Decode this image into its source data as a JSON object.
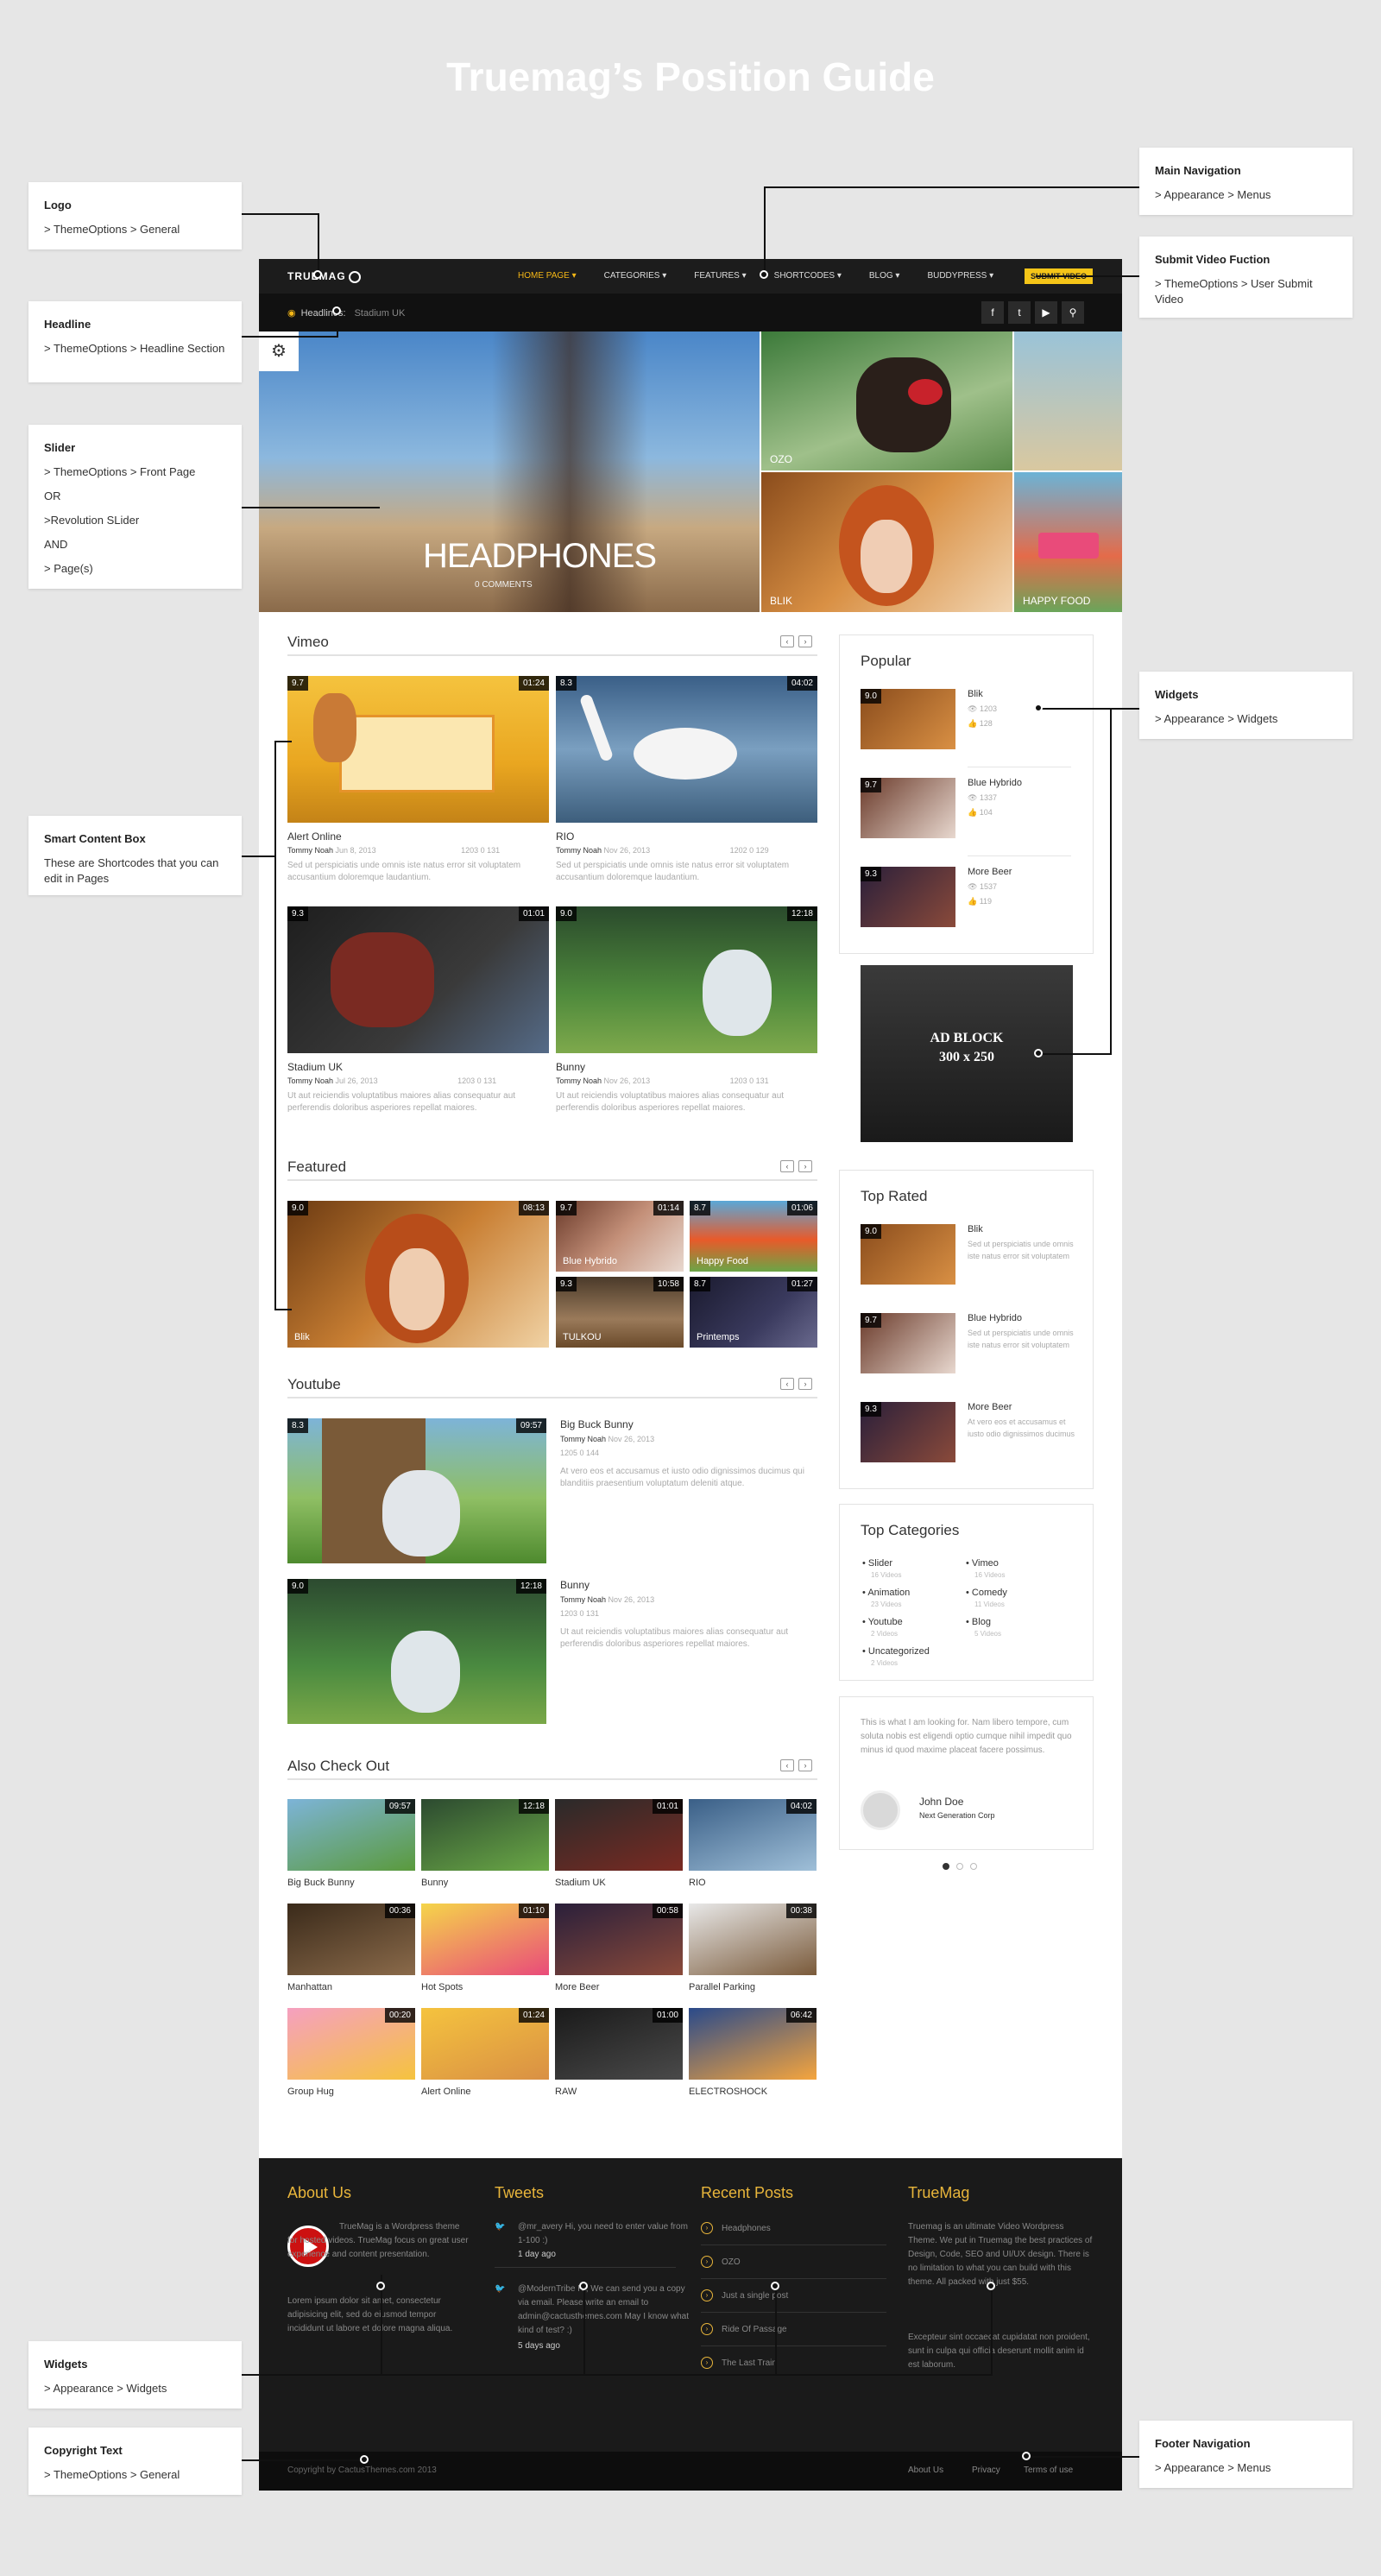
{
  "page_title": "Truemag’s Position Guide",
  "annotations": {
    "logo": {
      "title": "Logo",
      "text": "> ThemeOptions > General"
    },
    "headline": {
      "title": "Headline",
      "text": "> ThemeOptions > Headline Section"
    },
    "slider": {
      "title": "Slider",
      "lines": [
        "> ThemeOptions > Front Page",
        "OR",
        ">Revolution SLider",
        "AND",
        "> Page(s)"
      ]
    },
    "smart": {
      "title": "Smart Content Box",
      "text": "These are Shortcodes that you can edit in Pages"
    },
    "widgets_left": {
      "title": "Widgets",
      "text": "> Appearance > Widgets"
    },
    "copyright": {
      "title": "Copyright Text",
      "text": "> ThemeOptions > General"
    },
    "main_nav": {
      "title": "Main Navigation",
      "text": "> Appearance > Menus"
    },
    "submit": {
      "title": "Submit Video Fuction",
      "text": "> ThemeOptions > User Submit Video"
    },
    "widgets_right": {
      "title": "Widgets",
      "text": "> Appearance > Widgets"
    },
    "footer_nav": {
      "title": "Footer Navigation",
      "text": "> Appearance > Menus"
    }
  },
  "site": {
    "logo": "TRUEMAG",
    "nav": [
      "HOME PAGE ▾",
      "CATEGORIES ▾",
      "FEATURES ▾",
      "SHORTCODES ▾",
      "BLOG ▾",
      "BUDDYPRESS ▾"
    ],
    "submit_label": "SUBMIT VIDEO",
    "headline_label": "Headlines:",
    "headline_value": "Stadium UK",
    "social": [
      "f",
      "t",
      "▶",
      "⚲"
    ]
  },
  "slider": {
    "main_title": "HEADPHONES",
    "main_sub": "0 COMMENTS",
    "items": [
      "OZO",
      "",
      "BLIK",
      "HAPPY FOOD"
    ]
  },
  "sections": {
    "vimeo": "Vimeo",
    "featured": "Featured",
    "youtube": "Youtube",
    "also": "Also Check Out"
  },
  "vimeo_items": [
    {
      "rating": "9.7",
      "dur": "01:24",
      "title": "Alert Online",
      "author": "Tommy Noah",
      "date": "Jun 8, 2013",
      "stats": "1203  0  131",
      "excerpt": "Sed ut perspiciatis unde omnis iste natus error sit voluptatem accusantium doloremque laudantium."
    },
    {
      "rating": "8.3",
      "dur": "04:02",
      "title": "RIO",
      "author": "Tommy Noah",
      "date": "Nov 26, 2013",
      "stats": "1202  0  129",
      "excerpt": "Sed ut perspiciatis unde omnis iste natus error sit voluptatem accusantium doloremque laudantium."
    },
    {
      "rating": "9.3",
      "dur": "01:01",
      "title": "Stadium UK",
      "author": "Tommy Noah",
      "date": "Jul 26, 2013",
      "stats": "1203  0  131",
      "excerpt": "Ut aut reiciendis voluptatibus maiores alias consequatur aut perferendis doloribus asperiores repellat maiores."
    },
    {
      "rating": "9.0",
      "dur": "12:18",
      "title": "Bunny",
      "author": "Tommy Noah",
      "date": "Nov 26, 2013",
      "stats": "1203  0  131",
      "excerpt": "Ut aut reiciendis voluptatibus maiores alias consequatur aut perferendis doloribus asperiores repellat maiores."
    }
  ],
  "featured_items": [
    {
      "rating": "9.0",
      "dur": "08:13",
      "title": "Blik"
    },
    {
      "rating": "9.7",
      "dur": "01:14",
      "title": "Blue Hybrido"
    },
    {
      "rating": "8.7",
      "dur": "01:06",
      "title": "Happy Food"
    },
    {
      "rating": "9.3",
      "dur": "10:58",
      "title": "TULKOU"
    },
    {
      "rating": "8.7",
      "dur": "01:27",
      "title": "Printemps"
    }
  ],
  "youtube_items": [
    {
      "rating": "8.3",
      "dur": "09:57",
      "title": "Big Buck Bunny",
      "author": "Tommy Noah",
      "date": "Nov 26, 2013",
      "stats": "1205  0  144",
      "excerpt": "At vero eos et accusamus et iusto odio dignissimos ducimus qui blanditiis praesentium voluptatum deleniti atque."
    },
    {
      "rating": "9.0",
      "dur": "12:18",
      "title": "Bunny",
      "author": "Tommy Noah",
      "date": "Nov 26, 2013",
      "stats": "1203  0  131",
      "excerpt": "Ut aut reiciendis voluptatibus maiores alias consequatur aut perferendis doloribus asperiores repellat maiores."
    }
  ],
  "also_items": [
    {
      "dur": "09:57",
      "title": "Big Buck Bunny"
    },
    {
      "dur": "12:18",
      "title": "Bunny"
    },
    {
      "dur": "01:01",
      "title": "Stadium UK"
    },
    {
      "dur": "04:02",
      "title": "RIO"
    },
    {
      "dur": "00:36",
      "title": "Manhattan"
    },
    {
      "dur": "01:10",
      "title": "Hot Spots"
    },
    {
      "dur": "00:58",
      "title": "More Beer"
    },
    {
      "dur": "00:38",
      "title": "Parallel Parking"
    },
    {
      "dur": "00:20",
      "title": "Group Hug"
    },
    {
      "dur": "01:24",
      "title": "Alert Online"
    },
    {
      "dur": "01:00",
      "title": "RAW"
    },
    {
      "dur": "06:42",
      "title": "ELECTROSHOCK"
    }
  ],
  "sidebar": {
    "popular_title": "Popular",
    "popular": [
      {
        "rating": "9.0",
        "name": "Blik",
        "views": "1203",
        "likes": "128"
      },
      {
        "rating": "9.7",
        "name": "Blue Hybrido",
        "views": "1337",
        "likes": "104"
      },
      {
        "rating": "9.3",
        "name": "More Beer",
        "views": "1537",
        "likes": "119"
      }
    ],
    "ad_line1": "AD BLOCK",
    "ad_line2": "300 x 250",
    "top_rated_title": "Top Rated",
    "top_rated": [
      {
        "rating": "9.0",
        "name": "Blik",
        "text": "Sed ut perspiciatis unde omnis iste natus error sit voluptatem"
      },
      {
        "rating": "9.7",
        "name": "Blue Hybrido",
        "text": "Sed ut perspiciatis unde omnis iste natus error sit voluptatem"
      },
      {
        "rating": "9.3",
        "name": "More Beer",
        "text": "At vero eos et accusamus et iusto odio dignissimos ducimus"
      }
    ],
    "categories_title": "Top Categories",
    "categories": [
      {
        "name": "Slider",
        "count": "16 Videos"
      },
      {
        "name": "Vimeo",
        "count": "16 Videos"
      },
      {
        "name": "Animation",
        "count": "23 Videos"
      },
      {
        "name": "Comedy",
        "count": "11 Videos"
      },
      {
        "name": "Youtube",
        "count": "2 Videos"
      },
      {
        "name": "Blog",
        "count": "5 Videos"
      },
      {
        "name": "Uncategorized",
        "count": "2 Videos"
      }
    ],
    "testimonial": "This is what I am looking for. Nam libero tempore, cum soluta nobis est eligendi optio cumque nihil impedit quo minus id quod maxime placeat facere possimus.",
    "test_name": "John Doe",
    "test_role": "Next Generation Corp"
  },
  "footer": {
    "about_title": "About Us",
    "about_text1": "TrueMag is a Wordpress theme for hosted videos. TrueMag focus on great user experience and content presentation.",
    "about_text2": "Lorem ipsum dolor sit amet, consectetur adipisicing elit, sed do eiusmod tempor incididunt ut labore et dolore magna aliqua.",
    "tweets_title": "Tweets",
    "tweets": [
      {
        "text": "@mr_avery Hi, you need to enter value from 1-100 :)",
        "time": "1 day ago"
      },
      {
        "text": "@ModernTribe Hi, We can send you a copy via email. Please write an email to admin@cactusthemes.com May I know what kind of test? :)",
        "time": "5 days ago"
      }
    ],
    "recent_title": "Recent Posts",
    "recent": [
      "Headphones",
      "OZO",
      "Just a single post",
      "Ride Of Passage",
      "The Last Train"
    ],
    "truemag_title": "TrueMag",
    "truemag_text1": "Truemag is an ultimate Video Wordpress Theme. We put in Truemag the best practices of Design, Code, SEO and UI/UX design. There is no limitation to what you can build with this theme. All packed with just $55.",
    "truemag_text2": "Excepteur sint occaecat cupidatat non proident, sunt in culpa qui officia deserunt mollit anim id est laborum.",
    "copyright": "Copyright by CactusThemes.com 2013",
    "links": [
      "About Us",
      "Privacy",
      "Terms of use"
    ]
  },
  "colors": {
    "accent": "#e8b53b",
    "dark": "#1c1c1c",
    "bg": "#e6e6e6"
  }
}
